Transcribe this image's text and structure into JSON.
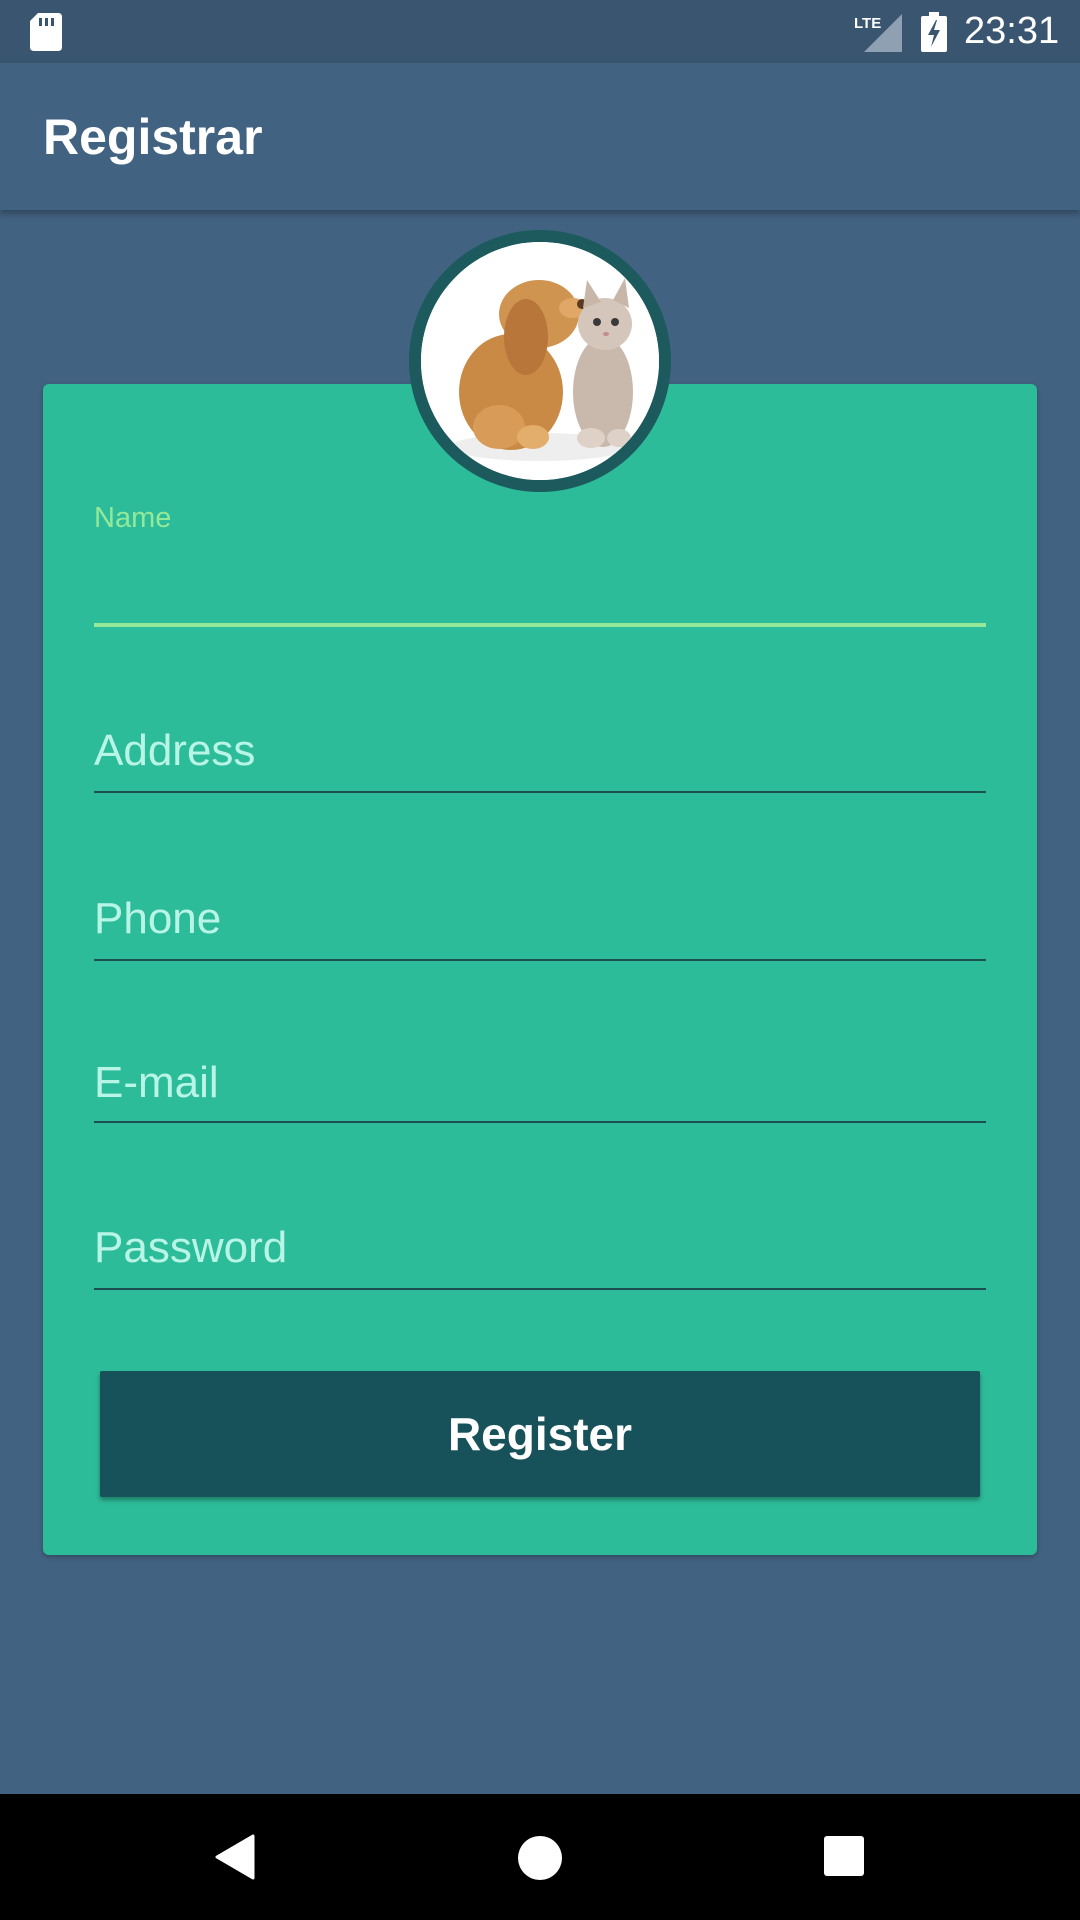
{
  "status_bar": {
    "network_label": "LTE",
    "time": "23:31",
    "icons": [
      "sd-card-icon",
      "lte-signal-icon",
      "battery-charging-icon"
    ]
  },
  "app_bar": {
    "title": "Registrar"
  },
  "avatar": {
    "description_icon": "puppy-kitten-avatar"
  },
  "form": {
    "name": {
      "label": "Name",
      "value": ""
    },
    "address": {
      "placeholder": "Address"
    },
    "phone": {
      "placeholder": "Phone"
    },
    "email": {
      "placeholder": "E-mail"
    },
    "password": {
      "placeholder": "Password"
    },
    "register_label": "Register"
  },
  "nav_bar": {
    "icons": [
      "back-icon",
      "home-icon",
      "recents-icon"
    ]
  },
  "colors": {
    "background": "#426281",
    "status_bar": "#39556f",
    "card": "#2dbc99",
    "button": "#17525a",
    "active_field": "#94e89a",
    "placeholder": "#b9f5e6",
    "avatar_ring": "#1c5a5e"
  }
}
